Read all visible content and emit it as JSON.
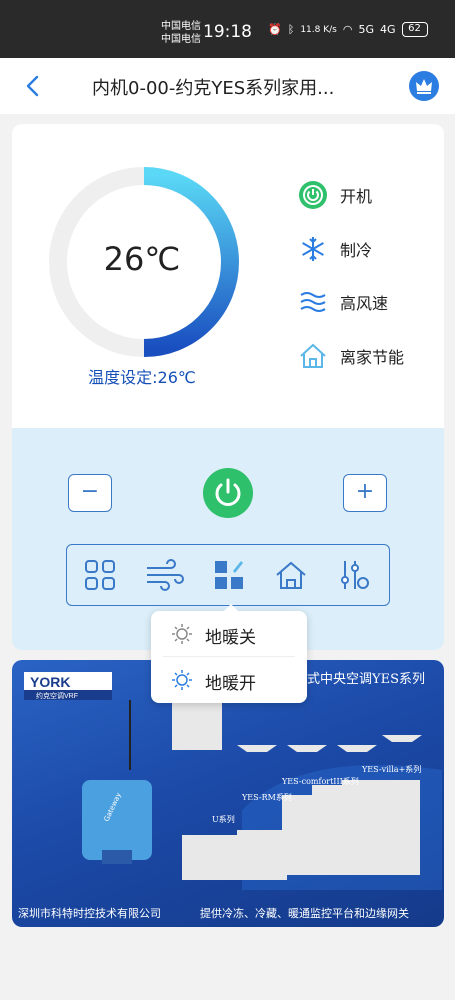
{
  "statusbar": {
    "carrier1": "中国电信",
    "carrier2": "中国电信",
    "time": "19:18",
    "netspeed": "11.8 K/s",
    "signal1": "5G",
    "signal2": "4G",
    "battery": "62"
  },
  "header": {
    "title": "内机0-00-约克YES系列家用..."
  },
  "thermostat": {
    "temperature": "26℃",
    "setpoint_label": "温度设定:26℃",
    "ring_fill_fraction": 0.5
  },
  "status_items": [
    {
      "label": "开机",
      "icon": "power-icon"
    },
    {
      "label": "制冷",
      "icon": "snowflake-icon"
    },
    {
      "label": "高风速",
      "icon": "wind-icon"
    },
    {
      "label": "离家节能",
      "icon": "home-icon"
    }
  ],
  "controls": {
    "minus": "−",
    "plus": "+"
  },
  "popup": {
    "items": [
      "地暖关",
      "地暖开"
    ]
  },
  "banner": {
    "brand": "YORK",
    "brand_sub": "约克空调VRF",
    "headline": "式中央空调YES系列",
    "series": [
      "YES-villa+系列",
      "YES-comfortIII系列",
      "YES-RM系列",
      "U系列"
    ],
    "footer_left": "深圳市科特时控技术有限公司",
    "footer_right": "提供冷冻、冷藏、暖通监控平台和边缘网关",
    "gateway_label": "Gateway"
  },
  "colors": {
    "accent": "#1550b8",
    "power_green": "#2ec06a",
    "panel_blue": "#dbeef9"
  }
}
